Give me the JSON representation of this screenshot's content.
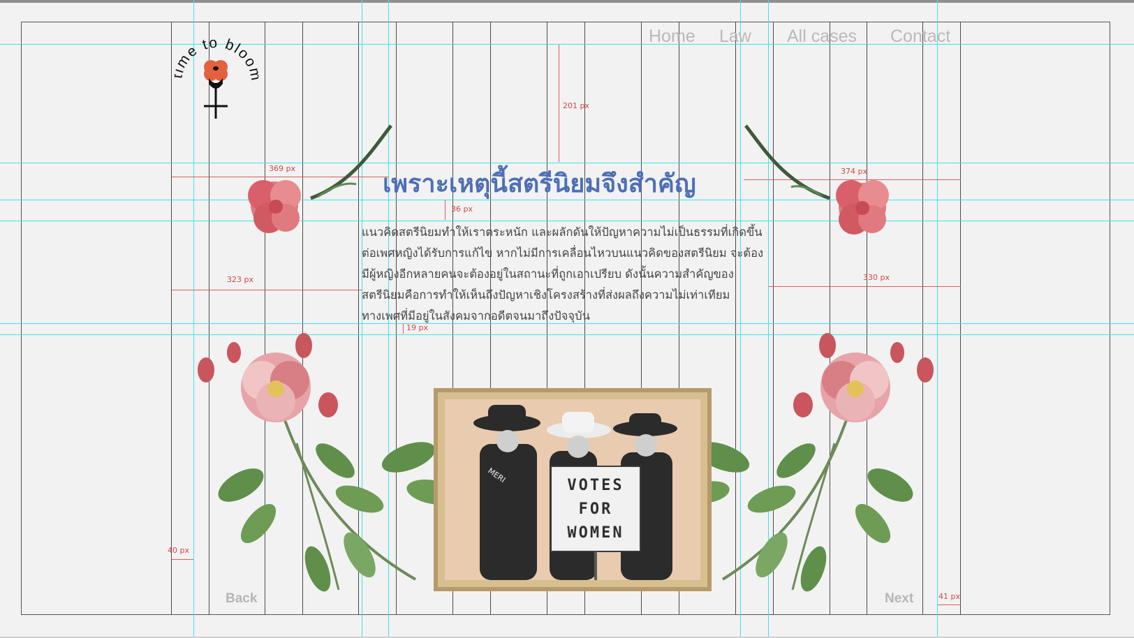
{
  "logo": {
    "text": "time to bloom",
    "colors": {
      "flower": "#e4613f",
      "stem": "#111111"
    }
  },
  "nav": {
    "home": "Home",
    "law": "Law",
    "all_cases": "All cases",
    "contact": "Contact"
  },
  "hero": {
    "title": "เพราะเหตุนี้สตรีนิยมจึงสำคัญ",
    "paragraph": "แนวคิดสตรีนิยมทำให้เราตระหนัก และผลักดันให้ปัญหาความไม่เป็นธรรมที่เกิดขึ้น\nต่อเพศหญิงได้รับการแก้ไข หากไม่มีการเคลื่อนไหวบนแนวคิดของสตรีนิยม จะต้อง\nมีผู้หญิงอีกหลายคนจะต้องอยู่ในสถานะที่ถูกเอาเปรียบ ดังนั้นความสำคัญของ\nสตรีนิยมคือการทำให้เห็นถึงปัญหาเชิงโครงสร้างที่ส่งผลถึงความไม่เท่าเทียม\nทางเพศที่มีอยู่ในสังคมจากอดีตจนมาถึงปัจจุบัน"
  },
  "photo": {
    "sign_line1": "VOTES",
    "sign_line2": "FOR",
    "sign_line3": "WOMEN",
    "sash": "MERI"
  },
  "footer": {
    "back": "Back",
    "next": "Next"
  },
  "measurements": {
    "m201": "201 px",
    "m369": "369 px",
    "m374": "374 px",
    "m36": "36 px",
    "m323": "323 px",
    "m330": "330 px",
    "m19": "19 px",
    "m40": "40 px",
    "m41": "41 px"
  },
  "colors": {
    "guide": "#3de2ea",
    "measure": "#e05a5a",
    "title": "#4d6fb5",
    "background": "#f2f2f2"
  }
}
